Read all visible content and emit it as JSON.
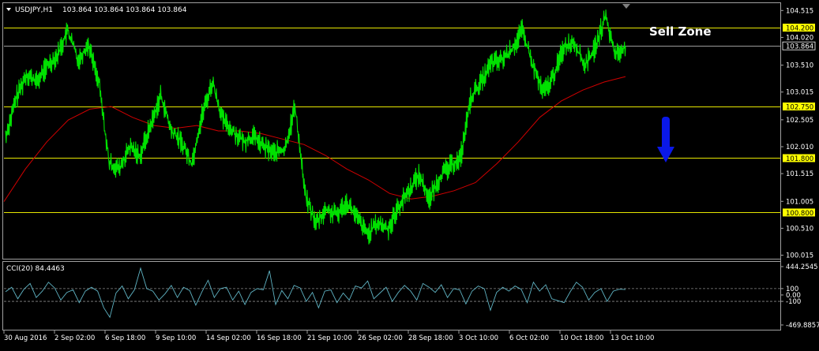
{
  "window": {
    "symbol_label": "USDJPY,H1",
    "ohlc_label": "103.864 103.864 103.864 103.864",
    "menu_icon": "triangle-down-icon"
  },
  "annotation": {
    "sell_zone_label": "Sell Zone",
    "arrow_icon": "arrow-down-icon",
    "arrow_color": "#0a18e8"
  },
  "colors": {
    "background": "#000000",
    "price": "#00e000",
    "moving_average": "#d00000",
    "levels": "#e6e600",
    "level_tag": "#ffff00",
    "cci": "#5fb3c3",
    "axis_text": "#ffffff",
    "frame": "#a0a0a0"
  },
  "chart_data": [
    {
      "type": "line",
      "title": "USDJPY,H1",
      "series": [
        {
          "name": "USDJPY",
          "points": [
            [
              "30 Aug 2016",
              102.2
            ],
            [
              "",
              102.9
            ],
            [
              "",
              103.35
            ],
            [
              "",
              103.2
            ],
            [
              "",
              103.5
            ],
            [
              "2 Sep 02:00",
              103.7
            ],
            [
              "",
              104.15
            ],
            [
              "",
              103.6
            ],
            [
              "",
              103.9
            ],
            [
              "",
              103.2
            ],
            [
              "6 Sep 18:00",
              101.7
            ],
            [
              "",
              101.6
            ],
            [
              "",
              102.0
            ],
            [
              "",
              101.85
            ],
            [
              "",
              102.4
            ],
            [
              "9 Sep 10:00",
              102.95
            ],
            [
              "",
              102.3
            ],
            [
              "",
              102.1
            ],
            [
              "",
              101.7
            ],
            [
              "",
              102.6
            ],
            [
              "14 Sep 02:00",
              103.2
            ],
            [
              "",
              102.5
            ],
            [
              "",
              102.3
            ],
            [
              "",
              102.1
            ],
            [
              "",
              102.2
            ],
            [
              "16 Sep 18:00",
              102.0
            ],
            [
              "",
              101.9
            ],
            [
              "",
              101.95
            ],
            [
              "",
              102.75
            ],
            [
              "",
              101.1
            ],
            [
              "21 Sep 10:00",
              100.6
            ],
            [
              "",
              100.85
            ],
            [
              "",
              100.75
            ],
            [
              "",
              101.0
            ],
            [
              "",
              100.7
            ],
            [
              "26 Sep 02:00",
              100.4
            ],
            [
              "",
              100.6
            ],
            [
              "",
              100.5
            ],
            [
              "",
              100.9
            ],
            [
              "",
              101.2
            ],
            [
              "28 Sep 18:00",
              101.5
            ],
            [
              "",
              101.05
            ],
            [
              "",
              101.45
            ],
            [
              "",
              101.65
            ],
            [
              "",
              101.8
            ],
            [
              "3 Oct 10:00",
              102.9
            ],
            [
              "",
              103.2
            ],
            [
              "",
              103.55
            ],
            [
              "",
              103.6
            ],
            [
              "",
              103.8
            ],
            [
              "6 Oct 02:00",
              104.15
            ],
            [
              "",
              103.5
            ],
            [
              "",
              103.0
            ],
            [
              "",
              103.3
            ],
            [
              "",
              103.85
            ],
            [
              "10 Oct 18:00",
              103.95
            ],
            [
              "",
              103.5
            ],
            [
              "",
              103.8
            ],
            [
              "",
              104.4
            ],
            [
              "",
              103.7
            ],
            [
              "13 Oct 10:00",
              103.864
            ]
          ]
        },
        {
          "name": "MA",
          "values": [
            101.0,
            101.6,
            102.1,
            102.5,
            102.7,
            102.75,
            102.55,
            102.4,
            102.35,
            102.4,
            102.3,
            102.3,
            102.25,
            102.15,
            102.05,
            101.85,
            101.6,
            101.4,
            101.15,
            101.05,
            101.1,
            101.2,
            101.35,
            101.7,
            102.1,
            102.55,
            102.85,
            103.05,
            103.2,
            103.3
          ]
        }
      ],
      "y_ticks": [
        "104.515",
        "104.020",
        "103.510",
        "103.015",
        "102.505",
        "102.010",
        "101.515",
        "101.005",
        "100.510",
        "100.015"
      ],
      "ylim": [
        99.95,
        104.65
      ],
      "x_ticks": [
        "30 Aug 2016",
        "2 Sep 02:00",
        "6 Sep 18:00",
        "9 Sep 10:00",
        "14 Sep 02:00",
        "16 Sep 18:00",
        "21 Sep 10:00",
        "26 Sep 02:00",
        "28 Sep 18:00",
        "3 Oct 10:00",
        "6 Oct 02:00",
        "10 Oct 18:00",
        "13 Oct 10:00"
      ],
      "horizontal_levels": [
        {
          "label": "104.200",
          "value": 104.2,
          "tag": true
        },
        {
          "label": "103.864",
          "value": 103.864,
          "tag": false
        },
        {
          "label": "102.750",
          "value": 102.75,
          "tag": true
        },
        {
          "label": "101.800",
          "value": 101.8,
          "tag": true
        },
        {
          "label": "100.800",
          "value": 100.8,
          "tag": true
        }
      ],
      "grid": false
    },
    {
      "type": "line",
      "title": "CCI(20) 84.4463",
      "series": [
        {
          "name": "CCI(20)",
          "values": [
            50,
            120,
            -60,
            90,
            180,
            -40,
            60,
            200,
            110,
            -80,
            40,
            80,
            -120,
            60,
            120,
            60,
            -200,
            -350,
            30,
            140,
            -60,
            80,
            420,
            100,
            60,
            -80,
            20,
            150,
            -40,
            120,
            70,
            -160,
            50,
            230,
            -40,
            100,
            120,
            -80,
            60,
            -150,
            40,
            100,
            80,
            380,
            -150,
            70,
            -60,
            150,
            110,
            -100,
            40,
            -200,
            60,
            80,
            -120,
            30,
            -80,
            140,
            110,
            220,
            -60,
            30,
            120,
            -100,
            40,
            150,
            60,
            -80,
            180,
            120,
            40,
            160,
            -40,
            100,
            80,
            -140,
            60,
            140,
            100,
            -240,
            40,
            120,
            60,
            140,
            90,
            -120,
            200,
            60,
            160,
            -60,
            -90,
            -120,
            50,
            200,
            120,
            -80,
            40,
            100,
            -100,
            60,
            90,
            84.4463
          ]
        }
      ],
      "y_ticks": [
        "444.2545",
        "100",
        "0.00",
        "-100",
        "-469.8857"
      ],
      "ylim": [
        -469.8857,
        444.2545
      ],
      "reference_levels": [
        100,
        -100
      ]
    }
  ]
}
